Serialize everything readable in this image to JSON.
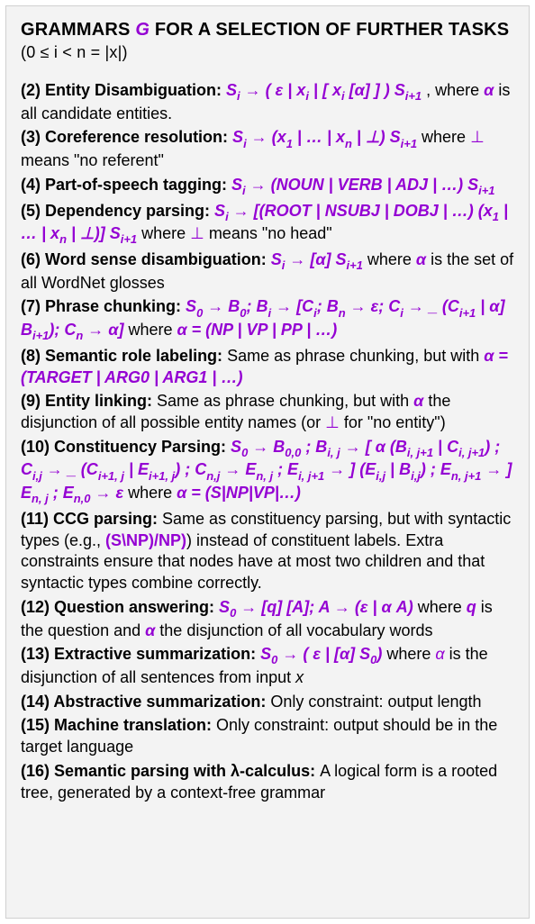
{
  "title": {
    "pre": "GRAMMARS ",
    "g": "G",
    "post": " FOR A SELECTION OF FURTHER TASKS",
    "cond": "  (0 ≤ i < n = |x|)"
  },
  "entries": {
    "e2": {
      "label": "(2) Entity Disambiguation:  ",
      "g_a": "S",
      "g_a_sub": "i",
      "g_b": " → ( ε | x",
      "g_b_sub": "i",
      "g_c": " | [ x",
      "g_c_sub": "i",
      "g_d": " [α] ] ) ",
      "g_e": "S",
      "g_e_sub": "i+1",
      "tail_a": " , where ",
      "alpha": "α",
      "tail_b": " is all candidate entities."
    },
    "e3": {
      "label": "(3) Coreference resolution:  ",
      "g_a": "S",
      "g_a_sub": "i",
      "g_b": " → (x",
      "g_b_sub": "1",
      "g_c": " | … | x",
      "g_c_sub": "n",
      "g_d": " | ⊥) ",
      "g_e": "S",
      "g_e_sub": "i+1",
      "tail_a": " where ",
      "bot": "⊥",
      "tail_b": " means \"no referent\""
    },
    "e4": {
      "label": "(4) Part-of-speech tagging:  ",
      "g_a": "S",
      "g_a_sub": "i",
      "g_b": " → (NOUN | VERB | ADJ | …) ",
      "g_c": "S",
      "g_c_sub": "i+1"
    },
    "e5": {
      "label": "(5) Dependency parsing:  ",
      "g_a": "S",
      "g_a_sub": "i",
      "g_b": " → [(ROOT | NSUBJ | DOBJ | …) (x",
      "g_b_sub": "1",
      "g_c": " | … | x",
      "g_c_sub": "n",
      "g_d": " | ⊥)] ",
      "g_e": "S",
      "g_e_sub": "i+1",
      "tail_a": "  where ",
      "bot": "⊥",
      "tail_b": " means \"no head\""
    },
    "e6": {
      "label": "(6) Word sense disambiguation:  ",
      "g_a": "S",
      "g_a_sub": "i",
      "g_b": " → [α]  ",
      "g_c": "S",
      "g_c_sub": "i+1",
      "tail_a": "  where ",
      "alpha": "α",
      "tail_b": " is the set of all WordNet glosses"
    },
    "e7": {
      "label": "(7) Phrase chunking:  ",
      "g_a": "S",
      "g_a_sub": "0",
      "g_b": " → B",
      "g_b_sub": "0",
      "g_c": ";  B",
      "g_c_sub": "i",
      "g_d": " → [C",
      "g_d_sub": "i",
      "g_e": ";  B",
      "g_e_sub": "n",
      "g_f": " → ε;  C",
      "g_f_sub": "i",
      "g_g": " → _ (C",
      "g_g_sub": "i+1",
      "g_h": " | α] B",
      "g_h_sub": "i+1",
      "g_i": ");  C",
      "g_i_sub": "n",
      "g_j": " → α]",
      "tail_a": "  where ",
      "tail_g": "α = (NP | VP | PP | …)"
    },
    "e8": {
      "label": "(8) Semantic role labeling:  ",
      "tail_a": "Same as phrase chunking, but with ",
      "tail_g": "α = (TARGET | ARG0 | ARG1 | …)"
    },
    "e9": {
      "label": "(9) Entity linking:  ",
      "tail_a": "Same as phrase chunking, but with ",
      "alpha": "α",
      "tail_b": " the disjunction of all possible entity names (or ",
      "bot": "⊥",
      "tail_c": " for \"no entity\")"
    },
    "e10": {
      "label": "(10) Constituency Parsing:  ",
      "g_a": "S",
      "g_a_sub": "0",
      "g_b": " → B",
      "g_b_sub": "0,0",
      "g_c": " ; B",
      "g_c_sub": "i, j",
      "g_d": " → [ α (B",
      "g_d_sub": "i, j+1",
      "g_e": " | C",
      "g_e_sub": "i, j+1",
      "g_f": ") ; C",
      "g_f_sub": "i,j",
      "g_g": " → _ (C",
      "g_g_sub": "i+1, j",
      "g_h": " | E",
      "g_h_sub": "i+1, j",
      "g_i": ") ; C",
      "g_i_sub": "n,j",
      "g_j": " → E",
      "g_j_sub": "n, j",
      "g_k": " ; E",
      "g_k_sub": "i, j+1",
      "g_l": " → ] (E",
      "g_l_sub": "i,j",
      "g_m": " | B",
      "g_m_sub": "i,j",
      "g_n": ") ; E",
      "g_n_sub": "n, j+1",
      "g_o": " → ] E",
      "g_o_sub": "n, j",
      "g_p": " ; E",
      "g_p_sub": "n,0",
      "g_q": " → ε",
      "tail_a": " where ",
      "tail_g": "α = (S|NP|VP|…)"
    },
    "e11": {
      "label": "(11) CCG parsing:  ",
      "tail_a": "Same as constituency parsing, but with syntactic types (e.g., ",
      "g_a": "(S\\NP)/NP)",
      "tail_b": ") instead of constituent labels. Extra constraints ensure that nodes have at most two children and that syntactic types combine correctly."
    },
    "e12": {
      "label": "(12) Question answering:  ",
      "g_a": "S",
      "g_a_sub": "0",
      "g_b": " → [q] [A];  A → (ε | α A)",
      "tail_a": " where ",
      "q": "q",
      "tail_b": " is the question and ",
      "alpha": "α",
      "tail_c": " the disjunction of all vocabulary words"
    },
    "e13": {
      "label": "(13) Extractive summarization:  ",
      "g_a": "S",
      "g_a_sub": "0",
      "g_b": " → ( ε | [α] S",
      "g_b_sub": "0",
      "g_c": ")",
      "tail_a": "  where ",
      "alpha": "α",
      "tail_b": " is the disjunction of all sentences from input ",
      "x": "x"
    },
    "e14": {
      "label": "(14) Abstractive summarization:  ",
      "tail_a": "Only constraint: output length"
    },
    "e15": {
      "label": "(15) Machine translation:  ",
      "tail_a": "Only constraint: output should be in the target language"
    },
    "e16": {
      "label": "(16) Semantic parsing with λ-calculus:  ",
      "tail_a": "A logical form is a rooted tree, generated by a context-free grammar"
    }
  }
}
